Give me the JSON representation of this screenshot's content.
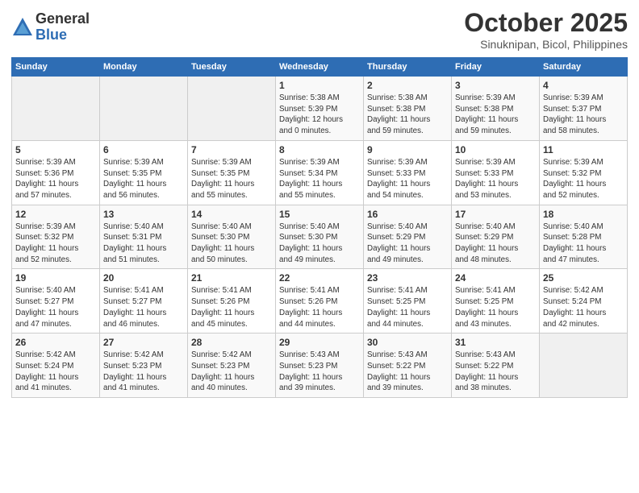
{
  "header": {
    "logo_general": "General",
    "logo_blue": "Blue",
    "month_title": "October 2025",
    "location": "Sinuknipan, Bicol, Philippines"
  },
  "days_of_week": [
    "Sunday",
    "Monday",
    "Tuesday",
    "Wednesday",
    "Thursday",
    "Friday",
    "Saturday"
  ],
  "weeks": [
    [
      {
        "day": "",
        "info": ""
      },
      {
        "day": "",
        "info": ""
      },
      {
        "day": "",
        "info": ""
      },
      {
        "day": "1",
        "info": "Sunrise: 5:38 AM\nSunset: 5:39 PM\nDaylight: 12 hours\nand 0 minutes."
      },
      {
        "day": "2",
        "info": "Sunrise: 5:38 AM\nSunset: 5:38 PM\nDaylight: 11 hours\nand 59 minutes."
      },
      {
        "day": "3",
        "info": "Sunrise: 5:39 AM\nSunset: 5:38 PM\nDaylight: 11 hours\nand 59 minutes."
      },
      {
        "day": "4",
        "info": "Sunrise: 5:39 AM\nSunset: 5:37 PM\nDaylight: 11 hours\nand 58 minutes."
      }
    ],
    [
      {
        "day": "5",
        "info": "Sunrise: 5:39 AM\nSunset: 5:36 PM\nDaylight: 11 hours\nand 57 minutes."
      },
      {
        "day": "6",
        "info": "Sunrise: 5:39 AM\nSunset: 5:35 PM\nDaylight: 11 hours\nand 56 minutes."
      },
      {
        "day": "7",
        "info": "Sunrise: 5:39 AM\nSunset: 5:35 PM\nDaylight: 11 hours\nand 55 minutes."
      },
      {
        "day": "8",
        "info": "Sunrise: 5:39 AM\nSunset: 5:34 PM\nDaylight: 11 hours\nand 55 minutes."
      },
      {
        "day": "9",
        "info": "Sunrise: 5:39 AM\nSunset: 5:33 PM\nDaylight: 11 hours\nand 54 minutes."
      },
      {
        "day": "10",
        "info": "Sunrise: 5:39 AM\nSunset: 5:33 PM\nDaylight: 11 hours\nand 53 minutes."
      },
      {
        "day": "11",
        "info": "Sunrise: 5:39 AM\nSunset: 5:32 PM\nDaylight: 11 hours\nand 52 minutes."
      }
    ],
    [
      {
        "day": "12",
        "info": "Sunrise: 5:39 AM\nSunset: 5:32 PM\nDaylight: 11 hours\nand 52 minutes."
      },
      {
        "day": "13",
        "info": "Sunrise: 5:40 AM\nSunset: 5:31 PM\nDaylight: 11 hours\nand 51 minutes."
      },
      {
        "day": "14",
        "info": "Sunrise: 5:40 AM\nSunset: 5:30 PM\nDaylight: 11 hours\nand 50 minutes."
      },
      {
        "day": "15",
        "info": "Sunrise: 5:40 AM\nSunset: 5:30 PM\nDaylight: 11 hours\nand 49 minutes."
      },
      {
        "day": "16",
        "info": "Sunrise: 5:40 AM\nSunset: 5:29 PM\nDaylight: 11 hours\nand 49 minutes."
      },
      {
        "day": "17",
        "info": "Sunrise: 5:40 AM\nSunset: 5:29 PM\nDaylight: 11 hours\nand 48 minutes."
      },
      {
        "day": "18",
        "info": "Sunrise: 5:40 AM\nSunset: 5:28 PM\nDaylight: 11 hours\nand 47 minutes."
      }
    ],
    [
      {
        "day": "19",
        "info": "Sunrise: 5:40 AM\nSunset: 5:27 PM\nDaylight: 11 hours\nand 47 minutes."
      },
      {
        "day": "20",
        "info": "Sunrise: 5:41 AM\nSunset: 5:27 PM\nDaylight: 11 hours\nand 46 minutes."
      },
      {
        "day": "21",
        "info": "Sunrise: 5:41 AM\nSunset: 5:26 PM\nDaylight: 11 hours\nand 45 minutes."
      },
      {
        "day": "22",
        "info": "Sunrise: 5:41 AM\nSunset: 5:26 PM\nDaylight: 11 hours\nand 44 minutes."
      },
      {
        "day": "23",
        "info": "Sunrise: 5:41 AM\nSunset: 5:25 PM\nDaylight: 11 hours\nand 44 minutes."
      },
      {
        "day": "24",
        "info": "Sunrise: 5:41 AM\nSunset: 5:25 PM\nDaylight: 11 hours\nand 43 minutes."
      },
      {
        "day": "25",
        "info": "Sunrise: 5:42 AM\nSunset: 5:24 PM\nDaylight: 11 hours\nand 42 minutes."
      }
    ],
    [
      {
        "day": "26",
        "info": "Sunrise: 5:42 AM\nSunset: 5:24 PM\nDaylight: 11 hours\nand 41 minutes."
      },
      {
        "day": "27",
        "info": "Sunrise: 5:42 AM\nSunset: 5:23 PM\nDaylight: 11 hours\nand 41 minutes."
      },
      {
        "day": "28",
        "info": "Sunrise: 5:42 AM\nSunset: 5:23 PM\nDaylight: 11 hours\nand 40 minutes."
      },
      {
        "day": "29",
        "info": "Sunrise: 5:43 AM\nSunset: 5:23 PM\nDaylight: 11 hours\nand 39 minutes."
      },
      {
        "day": "30",
        "info": "Sunrise: 5:43 AM\nSunset: 5:22 PM\nDaylight: 11 hours\nand 39 minutes."
      },
      {
        "day": "31",
        "info": "Sunrise: 5:43 AM\nSunset: 5:22 PM\nDaylight: 11 hours\nand 38 minutes."
      },
      {
        "day": "",
        "info": ""
      }
    ]
  ]
}
